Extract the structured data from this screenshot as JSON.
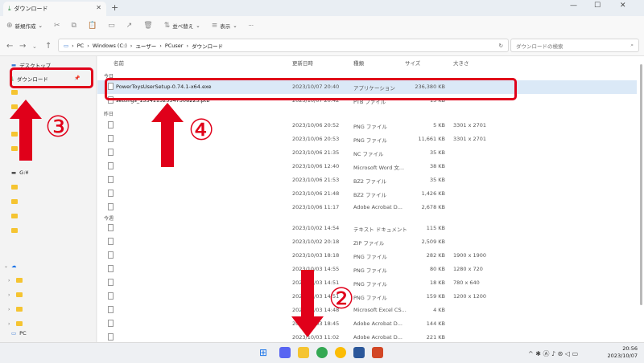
{
  "window": {
    "tab_title": "ダウンロード",
    "toolbar": {
      "new": "新規作成",
      "sort": "並べ替え",
      "view": "表示"
    },
    "address": [
      "PC",
      "Windows (C:)",
      "ユーザー",
      "PCuser",
      "ダウンロード"
    ],
    "search_placeholder": "ダウンロードの検索"
  },
  "sidebar": {
    "desktop": "デスクトップ",
    "downloads": "ダウンロード",
    "drive": "G:¥",
    "pc": "PC"
  },
  "columns": {
    "name": "名前",
    "date": "更新日時",
    "type": "種類",
    "size": "サイズ",
    "dims": "大きさ"
  },
  "groups": {
    "today": "今日",
    "yesterday": "昨日",
    "earlier": "今週"
  },
  "files": [
    {
      "name": "PowerToysUserSetup-0.74.1-x64.exe",
      "date": "2023/10/07 20:40",
      "type": "アプリケーション",
      "size": "236,380 KB",
      "dims": ""
    },
    {
      "name": "settings_133411525547308225.ptb",
      "date": "2023/10/07 20:42",
      "type": "PTB ファイル",
      "size": "15 KB",
      "dims": ""
    },
    {
      "name": "",
      "date": "2023/10/06 20:52",
      "type": "PNG ファイル",
      "size": "5 KB",
      "dims": "3301 x 2701"
    },
    {
      "name": "",
      "date": "2023/10/06 20:53",
      "type": "PNG ファイル",
      "size": "11,661 KB",
      "dims": "3301 x 2701"
    },
    {
      "name": "",
      "date": "2023/10/06 21:35",
      "type": "NC ファイル",
      "size": "35 KB",
      "dims": ""
    },
    {
      "name": "",
      "date": "2023/10/06 12:40",
      "type": "Microsoft Word 文...",
      "size": "38 KB",
      "dims": ""
    },
    {
      "name": "",
      "date": "2023/10/06 21:53",
      "type": "BZ2 ファイル",
      "size": "35 KB",
      "dims": ""
    },
    {
      "name": "",
      "date": "2023/10/06 21:48",
      "type": "BZ2 ファイル",
      "size": "1,426 KB",
      "dims": ""
    },
    {
      "name": "",
      "date": "2023/10/06 11:17",
      "type": "Adobe Acrobat D...",
      "size": "2,678 KB",
      "dims": ""
    },
    {
      "name": "",
      "date": "2023/10/02 14:54",
      "type": "テキスト ドキュメント",
      "size": "115 KB",
      "dims": ""
    },
    {
      "name": "",
      "date": "2023/10/02 20:18",
      "type": "ZIP ファイル",
      "size": "2,509 KB",
      "dims": ""
    },
    {
      "name": "",
      "date": "2023/10/03 18:18",
      "type": "PNG ファイル",
      "size": "282 KB",
      "dims": "1900 x 1900"
    },
    {
      "name": "",
      "date": "2023/10/03 14:55",
      "type": "PNG ファイル",
      "size": "80 KB",
      "dims": "1280 x 720"
    },
    {
      "name": "",
      "date": "2023/10/03 14:51",
      "type": "PNG ファイル",
      "size": "18 KB",
      "dims": "780 x 640"
    },
    {
      "name": "",
      "date": "2023/10/03 14:51",
      "type": "PNG ファイル",
      "size": "159 KB",
      "dims": "1200 x 1200"
    },
    {
      "name": "",
      "date": "2023/10/03 14:48",
      "type": "Microsoft Excel CS...",
      "size": "4 KB",
      "dims": ""
    },
    {
      "name": "",
      "date": "2023/10/03 18:45",
      "type": "Adobe Acrobat D...",
      "size": "144 KB",
      "dims": ""
    },
    {
      "name": "",
      "date": "2023/10/03 11:02",
      "type": "Adobe Acrobat D...",
      "size": "221 KB",
      "dims": ""
    }
  ],
  "annotations": {
    "n2": "②",
    "n3": "③",
    "n4": "④"
  },
  "clock": {
    "time": "20:56",
    "date": "2023/10/07"
  },
  "colors": {
    "accent": "#e0001a",
    "selection": "#dbe9f7",
    "folder": "#f5c431"
  }
}
